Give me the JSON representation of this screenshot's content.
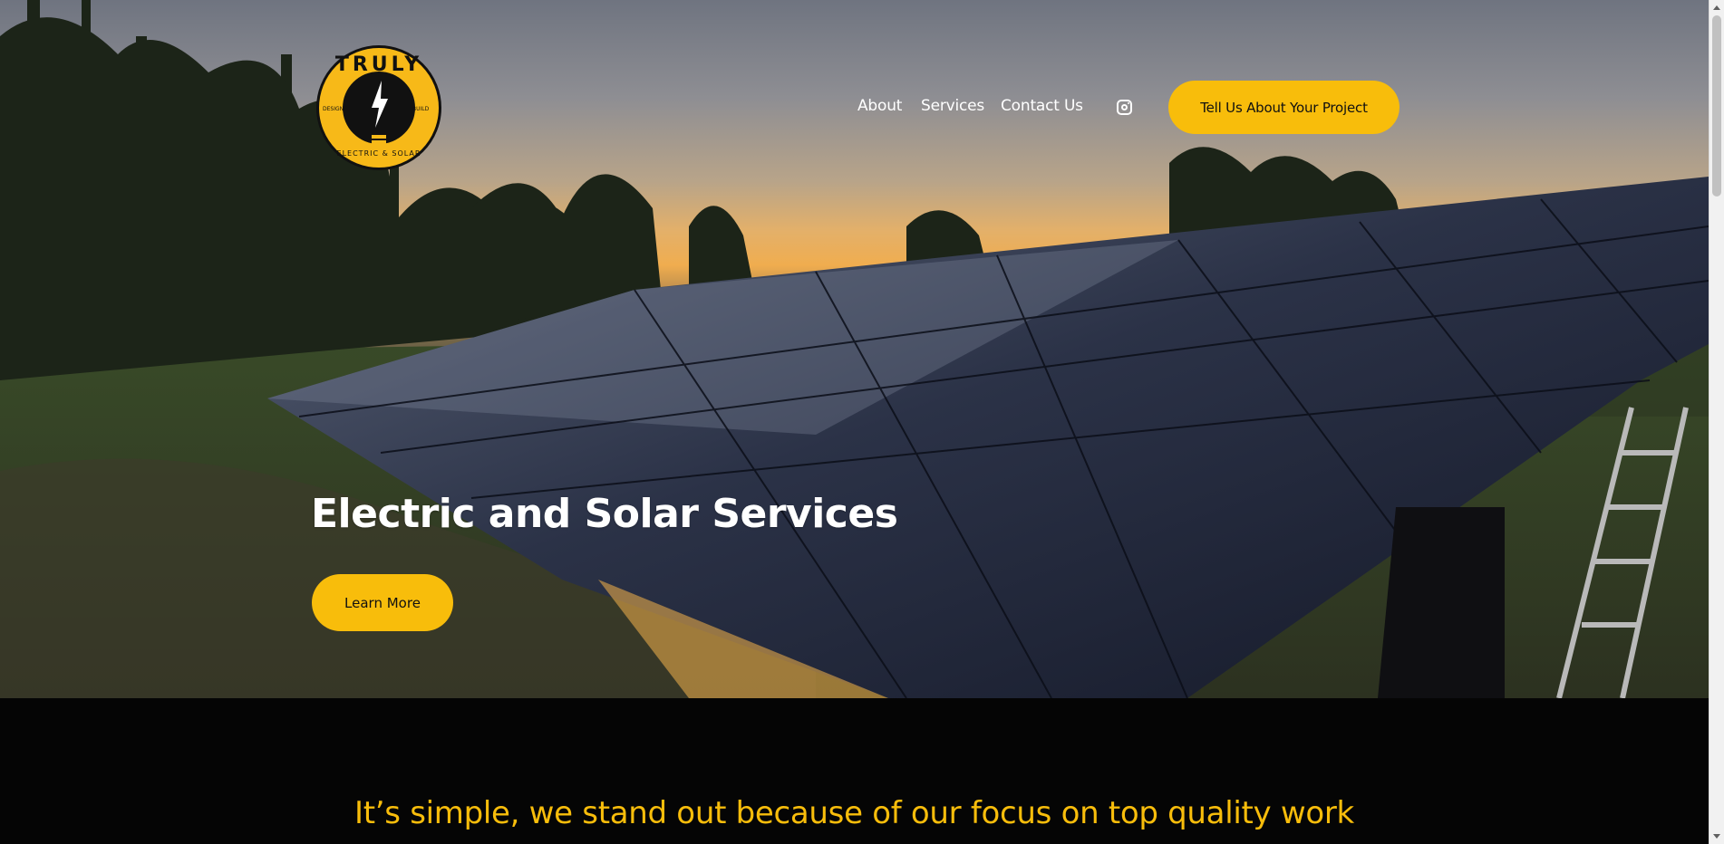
{
  "brand": {
    "logo_name": "TRULY",
    "logo_left": "DESIGN",
    "logo_right": "BUILD",
    "logo_bottom": "ELECTRIC & SOLAR"
  },
  "nav": {
    "about": "About",
    "services": "Services",
    "contact": "Contact Us",
    "instagram_icon": "instagram-icon"
  },
  "cta": {
    "label": "Tell Us About Your Project"
  },
  "hero": {
    "title": "Electric and Solar Services",
    "button": "Learn More"
  },
  "section": {
    "tagline": "It’s simple, we stand out because of our focus on top quality work"
  },
  "colors": {
    "accent": "#f8bd0b",
    "text_light": "#ffffff",
    "dark_bg": "#050505"
  }
}
